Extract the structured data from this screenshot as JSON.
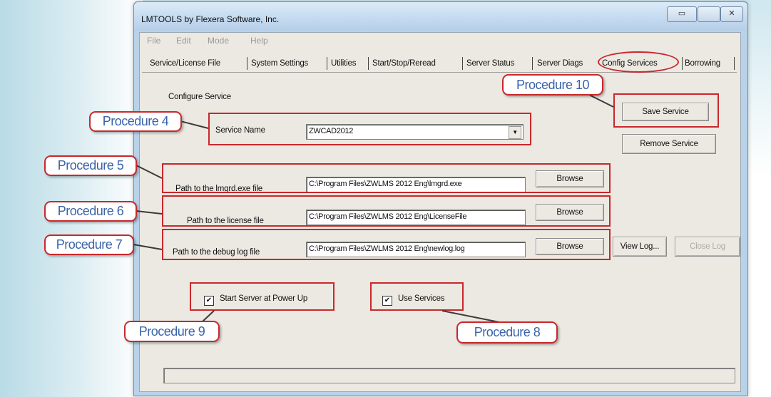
{
  "window": {
    "title": "LMTOOLS by Flexera Software, Inc.",
    "minimize_glyph": "▭",
    "close_glyph": "✕"
  },
  "menu": [
    "File",
    "Edit",
    "Mode",
    "Help"
  ],
  "tabs": [
    "Service/License File",
    "System Settings",
    "Utilities",
    "Start/Stop/Reread",
    "Server Status",
    "Server Diags",
    "Config Services",
    "Borrowing"
  ],
  "config": {
    "section_label": "Configure Service",
    "service_name_label": "Service Name",
    "service_name_value": "ZWCAD2012",
    "lmgrd_label": "Path to the lmgrd.exe file",
    "lmgrd_value": "C:\\Program Files\\ZWLMS 2012 Eng\\lmgrd.exe",
    "license_label": "Path to the license file",
    "license_value": "C:\\Program Files\\ZWLMS 2012 Eng\\LicenseFile",
    "debug_label": "Path to the debug log file",
    "debug_value": "C:\\Program Files\\ZWLMS 2012 Eng\\newlog.log",
    "browse_label": "Browse",
    "save_service": "Save Service",
    "remove_service": "Remove Service",
    "view_log": "View Log...",
    "close_log": "Close Log",
    "start_server_label": "Start Server at Power Up",
    "use_services_label": "Use Services",
    "checkmark": "✔"
  },
  "callouts": {
    "p4": "Procedure 4",
    "p5": "Procedure 5",
    "p6": "Procedure 6",
    "p7": "Procedure 7",
    "p8": "Procedure 8",
    "p9": "Procedure 9",
    "p10": "Procedure 10"
  },
  "colors": {
    "highlight_red": "#c8282c",
    "callout_text": "#3a63a8",
    "dialog_bg": "#ece9e2"
  }
}
